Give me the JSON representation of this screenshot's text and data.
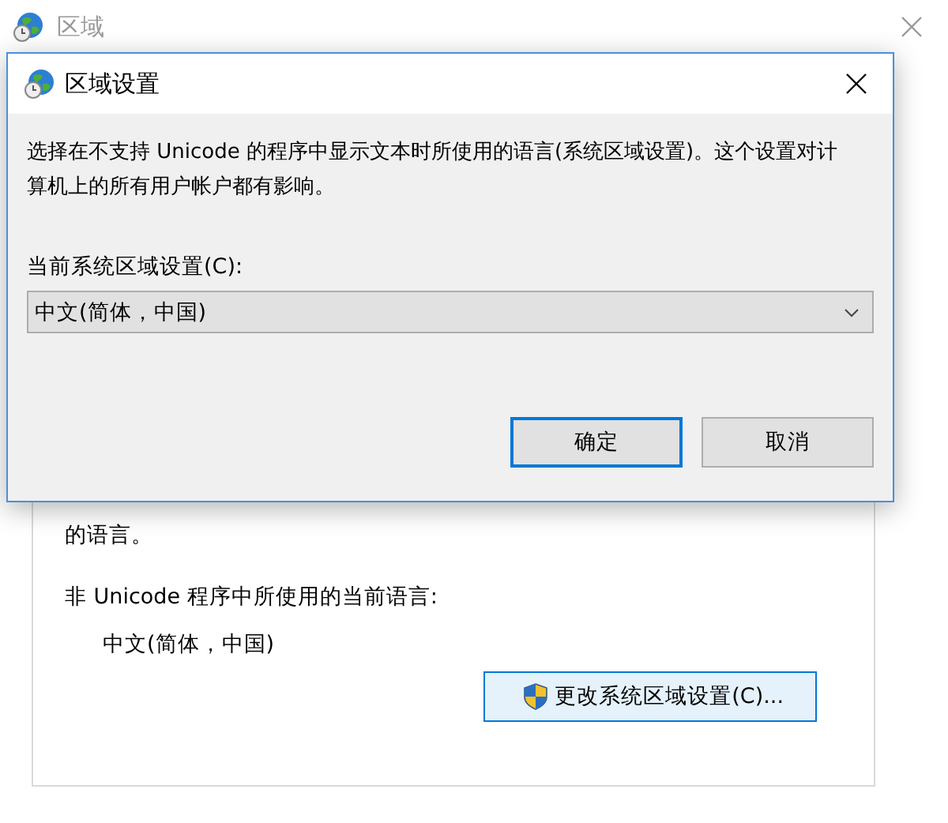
{
  "window": {
    "title": "区域"
  },
  "background_panel": {
    "description": "的语言。",
    "current_language_label": "非 Unicode 程序中所使用的当前语言:",
    "current_language": "中文(简体，中国)",
    "change_button": "更改系统区域设置(C)..."
  },
  "dialog": {
    "title": "区域设置",
    "description": "选择在不支持 Unicode 的程序中显示文本时所使用的语言(系统区域设置)。这个设置对计算机上的所有用户帐户都有影响。",
    "locale_label": "当前系统区域设置(C):",
    "locale_value": "中文(简体，中国)",
    "buttons": [
      {
        "label": "确定",
        "selected": true
      },
      {
        "label": "取消",
        "selected": false
      }
    ]
  }
}
